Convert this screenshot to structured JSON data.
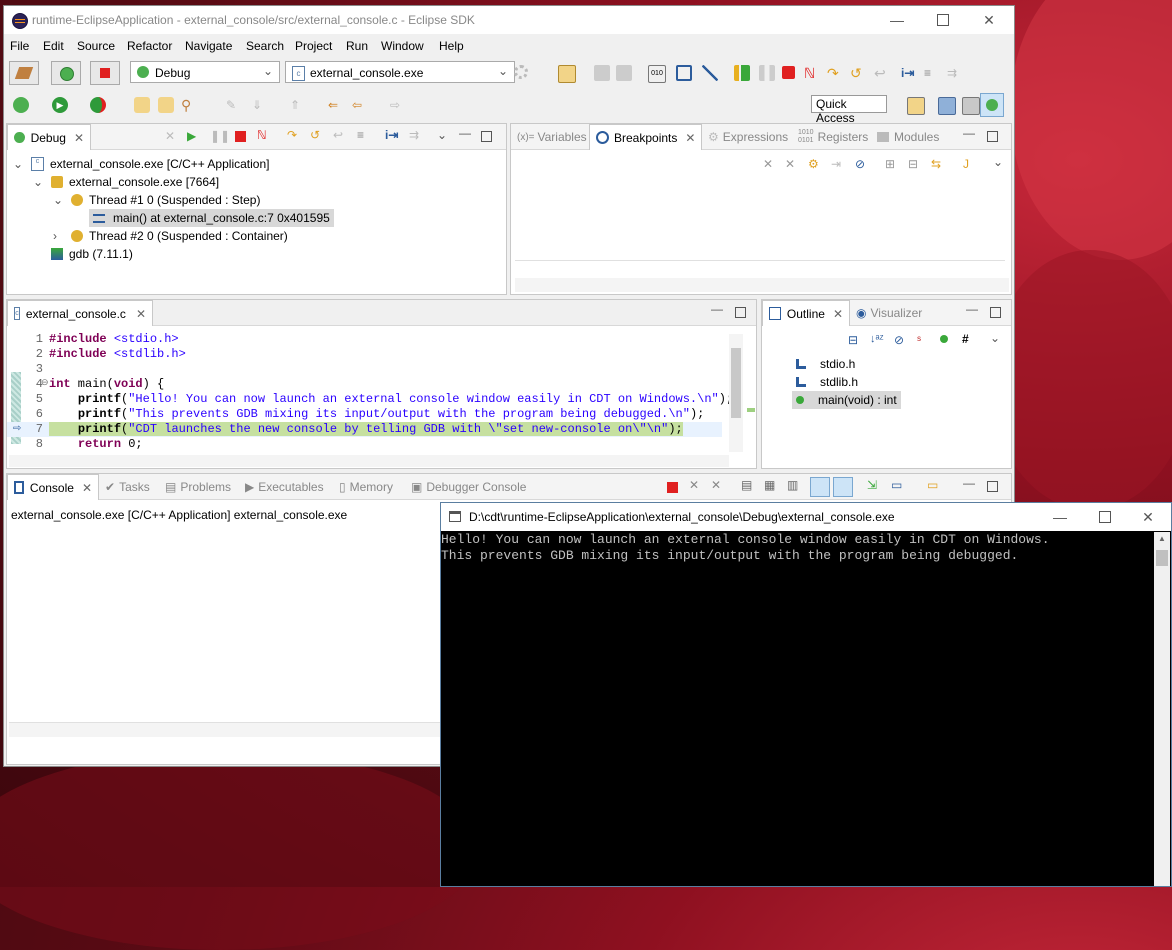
{
  "window": {
    "title": "runtime-EclipseApplication - external_console/src/external_console.c - Eclipse SDK"
  },
  "menu": [
    "File",
    "Edit",
    "Source",
    "Refactor",
    "Navigate",
    "Search",
    "Project",
    "Run",
    "Window",
    "Help"
  ],
  "toolbar": {
    "launch_mode": "Debug",
    "launch_config": "external_console.exe",
    "quick_access": "Quick Access"
  },
  "debug_view": {
    "tab": "Debug",
    "tree": [
      {
        "label": "external_console.exe [C/C++ Application]"
      },
      {
        "label": "external_console.exe [7664]"
      },
      {
        "label": "Thread #1 0 (Suspended : Step)"
      },
      {
        "label": "main() at external_console.c:7 0x401595"
      },
      {
        "label": "Thread #2 0 (Suspended : Container)"
      },
      {
        "label": "gdb (7.11.1)"
      }
    ]
  },
  "vars_view": {
    "tabs": [
      "Variables",
      "Breakpoints",
      "Expressions",
      "Registers",
      "Modules"
    ]
  },
  "editor": {
    "tab": "external_console.c",
    "lines": [
      {
        "n": "1",
        "text": "#include <stdio.h>"
      },
      {
        "n": "2",
        "text": "#include <stdlib.h>"
      },
      {
        "n": "3",
        "text": ""
      },
      {
        "n": "4",
        "text": "int main(void) {"
      },
      {
        "n": "5",
        "text": "    printf(\"Hello! You can now launch an external console window easily in CDT on Windows.\\n\");"
      },
      {
        "n": "6",
        "text": "    printf(\"This prevents GDB mixing its input/output with the program being debugged.\\n\");"
      },
      {
        "n": "7",
        "text": "    printf(\"CDT launches the new console by telling GDB with \\\"set new-console on\\\"\\n\");"
      },
      {
        "n": "8",
        "text": "    return 0;"
      }
    ]
  },
  "outline": {
    "tabs": [
      "Outline",
      "Visualizer"
    ],
    "items": [
      "stdio.h",
      "stdlib.h",
      "main(void) : int"
    ]
  },
  "console_view": {
    "tabs": [
      "Console",
      "Tasks",
      "Problems",
      "Executables",
      "Memory",
      "Debugger Console"
    ],
    "process": "external_console.exe [C/C++ Application] external_console.exe"
  },
  "cmd_window": {
    "title": "D:\\cdt\\runtime-EclipseApplication\\external_console\\Debug\\external_console.exe",
    "output": [
      "Hello! You can now launch an external console window easily in CDT on Windows.",
      "This prevents GDB mixing its input/output with the program being debugged."
    ]
  }
}
